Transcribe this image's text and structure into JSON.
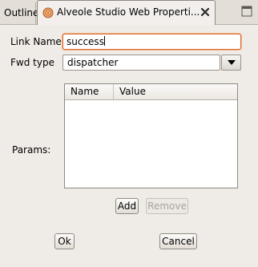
{
  "tabs": {
    "outline_label": "Outline",
    "active_label": "Alveole Studio Web Properti..."
  },
  "form": {
    "link_name_label": "Link Name",
    "link_name_value": "success",
    "fwd_type_label": "Fwd type",
    "fwd_type_value": "dispatcher",
    "params_label": "Params:"
  },
  "table": {
    "columns": [
      "Name",
      "Value"
    ],
    "rows": []
  },
  "buttons": {
    "add": "Add",
    "remove": "Remove",
    "ok": "Ok",
    "cancel": "Cancel"
  },
  "icons": {
    "tab_icon": "alveole-studio-icon",
    "close": "close-icon",
    "corner": "view-menu-icon",
    "dropdown": "chevron-down-icon"
  },
  "colors": {
    "focus_border": "#d76c33",
    "background": "#efebe7"
  }
}
